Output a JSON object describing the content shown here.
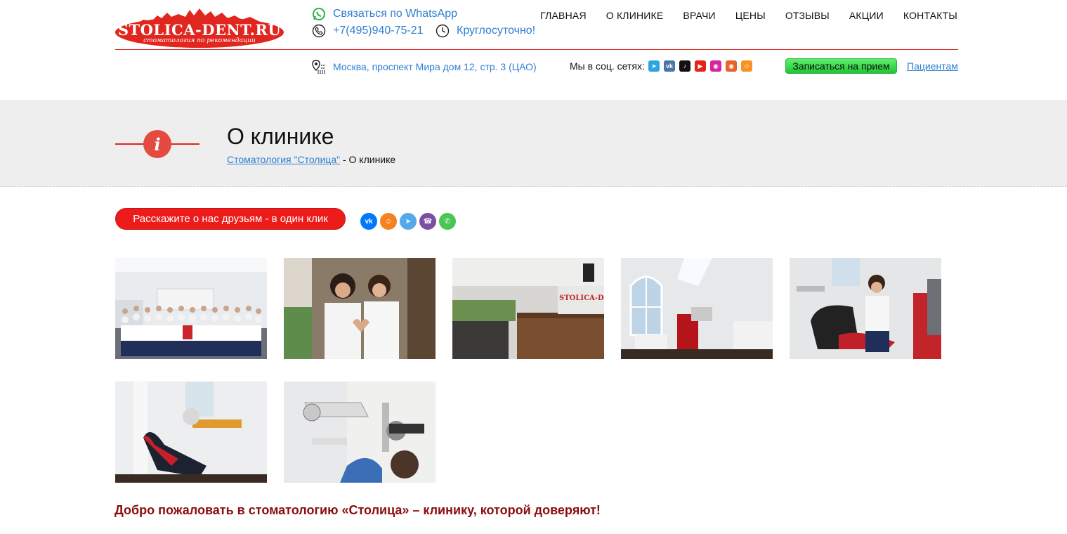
{
  "header": {
    "logo_text": "STOLICA-DENT.RU",
    "logo_sub": "стоматология по рекомендации",
    "whatsapp": "Связаться по WhatsApp",
    "phone": "+7(495)940-75-21",
    "hours": "Круглосуточно!",
    "address": "Москва, проспект Мира дом 12, стр. 3 (ЦАО)",
    "social_label": "Мы в соц. сетях:",
    "appointment": "Записаться на прием",
    "patients": "Пациентам"
  },
  "nav": {
    "items": [
      "ГЛАВНАЯ",
      "О КЛИНИКЕ",
      "ВРАЧИ",
      "ЦЕНЫ",
      "ОТЗЫВЫ",
      "АКЦИИ",
      "КОНТАКТЫ"
    ]
  },
  "social": {
    "icons": [
      "telegram-icon",
      "vk-icon",
      "tiktok-icon",
      "youtube-icon",
      "instagram-icon",
      "instagram-icon",
      "odnoklassniki-icon"
    ],
    "colors": [
      "#2ca5e0",
      "#4a76a8",
      "#111111",
      "#e62117",
      "#d6249f",
      "#e8622b",
      "#f7931e"
    ]
  },
  "title_band": {
    "title": "О клинике",
    "crumb_link": "Стоматология \"Столица\"",
    "crumb_current": " - О клинике"
  },
  "share": {
    "label": "Расскажите о нас друзьям - в один клик",
    "icons": [
      "vk-icon",
      "odnoklassniki-icon",
      "telegram-icon",
      "viber-icon",
      "whatsapp-icon"
    ],
    "colors": [
      "#0077ff",
      "#f58220",
      "#54a9eb",
      "#7d4fa1",
      "#4bc553"
    ]
  },
  "colors": {
    "accent_red": "#e0261e",
    "link_blue": "#2f7fd1",
    "welcome_red": "#8b0d0d"
  },
  "welcome": "Добро пожаловать в стоматологию «Столица» – клинику, которой доверяют!"
}
